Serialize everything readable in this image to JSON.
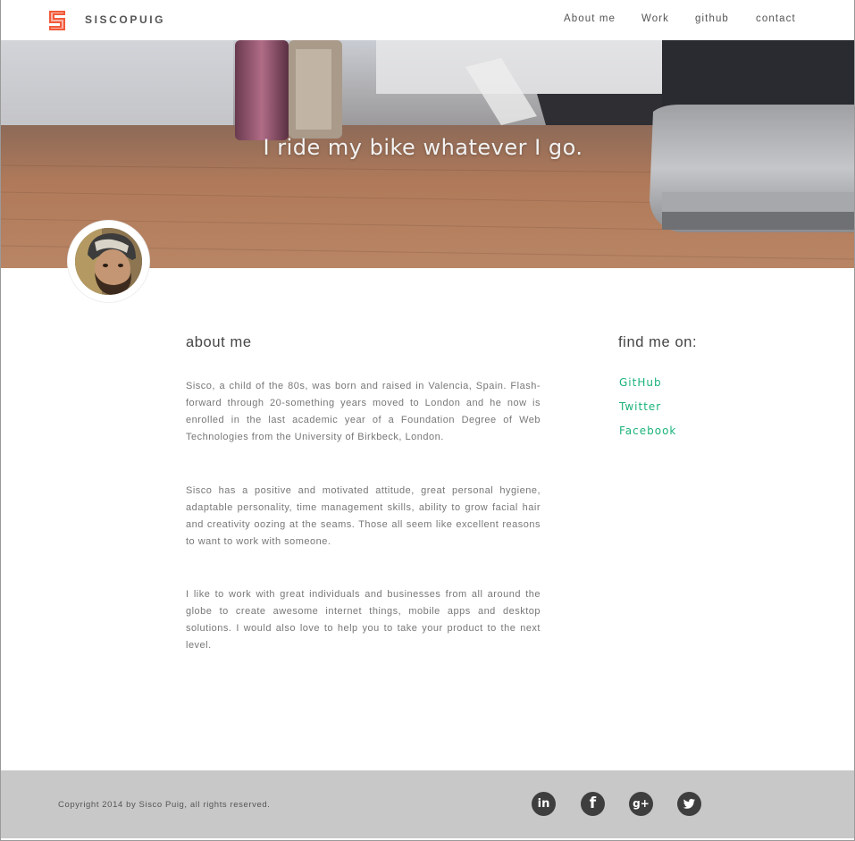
{
  "header": {
    "brand": "SISCOPUIG",
    "nav": [
      {
        "label": "About me"
      },
      {
        "label": "Work"
      },
      {
        "label": "github"
      },
      {
        "label": "contact"
      }
    ]
  },
  "hero": {
    "tagline": "I ride my bike whatever I go."
  },
  "about": {
    "title": "about me",
    "paragraphs": [
      "Sisco, a child of the 80s, was born and raised in Valencia, Spain. Flash-forward through 20-something years moved to London and he now is enrolled in the last academic year of a Foundation Degree of Web Technologies from the University of Birkbeck, London.",
      "Sisco has a positive and motivated attitude, great personal hygiene, adaptable personality, time management skills, ability to grow facial hair and creativity oozing at the seams. Those all seem like excellent reasons to want to work with someone.",
      "I like to work with great individuals and businesses from all around the globe to create awesome internet things, mobile apps and desktop solutions. I would also love to help you to take your product to the next level."
    ]
  },
  "find": {
    "title": "find me on:",
    "links": [
      {
        "label": "GitHub"
      },
      {
        "label": "Twitter"
      },
      {
        "label": "Facebook"
      }
    ]
  },
  "footer": {
    "copyright": "Copyright 2014 by Sisco Puig, all rights reserved.",
    "icons": [
      {
        "name": "linkedin-icon",
        "glyph": "in"
      },
      {
        "name": "facebook-icon",
        "glyph": "f"
      },
      {
        "name": "google-plus-icon",
        "glyph": "g+"
      },
      {
        "name": "twitter-icon",
        "glyph": ""
      }
    ]
  },
  "colors": {
    "logo": "#f15a3a",
    "link": "#1bb37a",
    "footer_bg": "#c8c8c8",
    "footer_icon": "#3e3e3e"
  }
}
